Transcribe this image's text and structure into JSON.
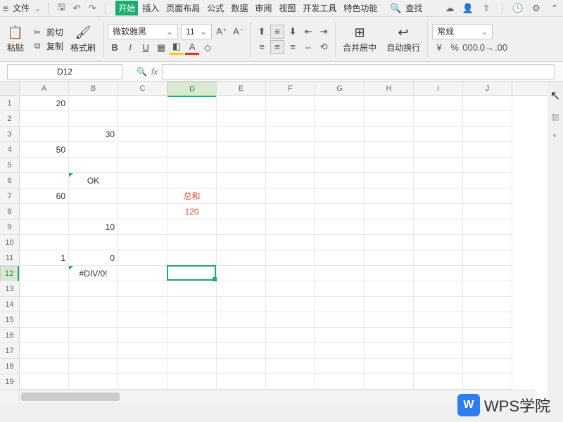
{
  "menu": {
    "file": "文件",
    "tabs": [
      "开始",
      "插入",
      "页面布局",
      "公式",
      "数据",
      "审阅",
      "视图",
      "开发工具",
      "特色功能"
    ],
    "active": 0,
    "search": "查找"
  },
  "ribbon": {
    "paste": "粘贴",
    "cut": "剪切",
    "copy": "复制",
    "format_painter": "格式刷",
    "font": "微软雅黑",
    "size": "11",
    "merge": "合并居中",
    "wrap": "自动换行",
    "numfmt": "常规"
  },
  "namebox": "D12",
  "columns": [
    "A",
    "B",
    "C",
    "D",
    "E",
    "F",
    "G",
    "H",
    "I",
    "J"
  ],
  "rows": [
    "1",
    "2",
    "3",
    "4",
    "5",
    "6",
    "7",
    "8",
    "9",
    "10",
    "11",
    "12",
    "13",
    "14",
    "15",
    "16",
    "17",
    "18",
    "19"
  ],
  "cells": {
    "A1": "20",
    "B3": "30",
    "A4": "50",
    "B6": "OK",
    "A7": "60",
    "D7": "总和",
    "D8": "120",
    "B9": "10",
    "A11": "1",
    "B11": "0",
    "B12": "#DIV/0!"
  },
  "selected": {
    "row": 12,
    "col": "D"
  },
  "watermark": "WPS学院"
}
